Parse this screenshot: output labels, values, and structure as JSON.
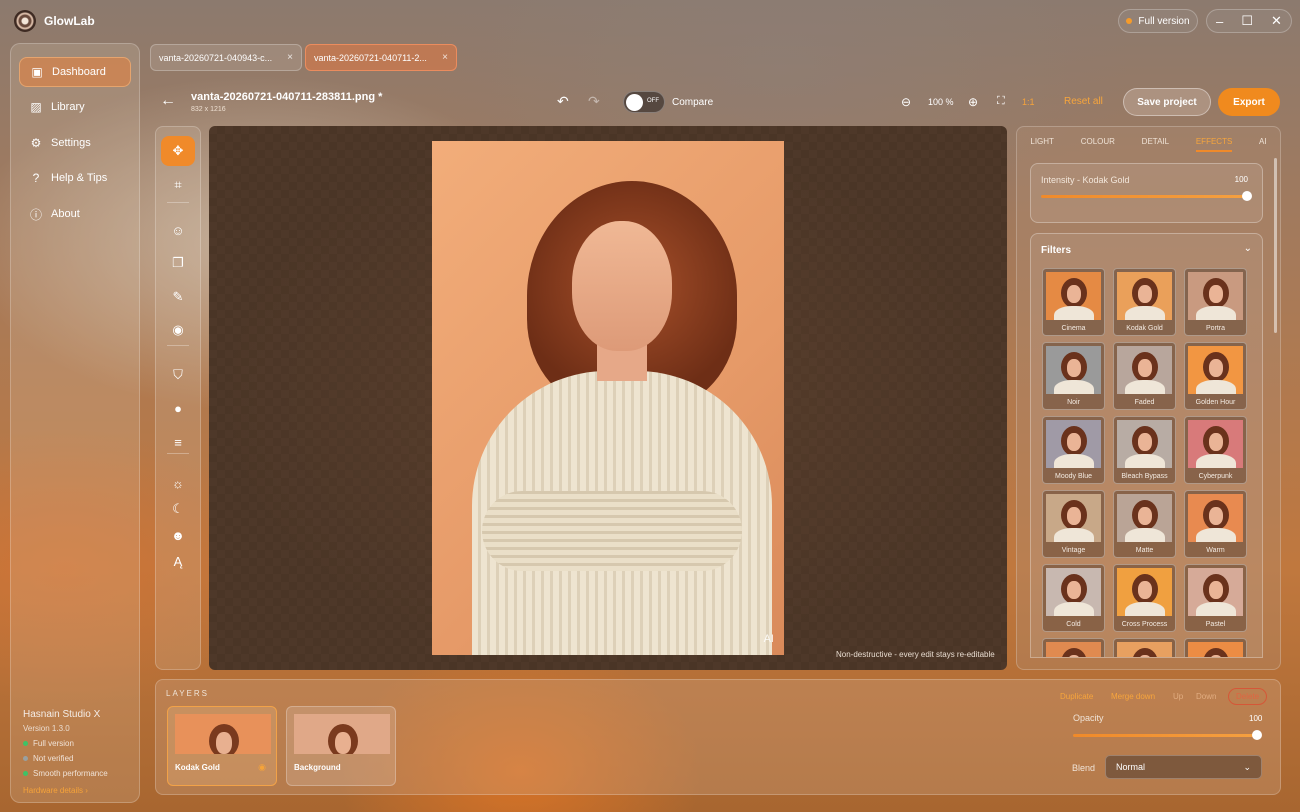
{
  "app": {
    "title": "GlowLab",
    "badge": "Full version"
  },
  "window_controls": {
    "minimize": "–",
    "maximize": "☐",
    "close": "✕"
  },
  "sidebar": {
    "items": [
      {
        "label": "Dashboard",
        "icon": "dashboard-icon",
        "glyph": "▣",
        "active": true
      },
      {
        "label": "Library",
        "icon": "image-icon",
        "glyph": "▨",
        "active": false
      },
      {
        "label": "Settings",
        "icon": "gear-icon",
        "glyph": "⚙",
        "active": false
      },
      {
        "label": "Help & Tips",
        "icon": "question-icon",
        "glyph": "?",
        "active": false
      },
      {
        "label": "About",
        "icon": "info-icon",
        "glyph": "ⓘ",
        "active": false
      }
    ],
    "studio": "Hasnain Studio X",
    "version": "Version 1.3.0",
    "status": [
      "Full version",
      "Not verified",
      "Smooth performance"
    ],
    "hardware_link": "Hardware details ›"
  },
  "tabs": [
    {
      "label": "vanta-20260721-040943-c...",
      "close": "×"
    },
    {
      "label": "vanta-20260721-040711-2...",
      "close": "×"
    }
  ],
  "header": {
    "back": "←",
    "filename": "vanta-20260721-040711-283811.png *",
    "dimensions": "832 x 1216",
    "undo": "↶",
    "redo": "↷",
    "toggle_state": "OFF",
    "compare": "Compare",
    "zoom_out": "⊖",
    "zoom": "100 %",
    "zoom_in": "⊕",
    "fit": "⛶",
    "one_to_one": "1:1",
    "reset": "Reset all",
    "save": "Save project",
    "export": "Export"
  },
  "tools": [
    {
      "name": "move-tool",
      "glyph": "✥"
    },
    {
      "name": "crop-tool",
      "glyph": "⌗"
    },
    {
      "name": "palette-tool",
      "glyph": "☺"
    },
    {
      "name": "clone-tool",
      "glyph": "❐"
    },
    {
      "name": "heal-tool",
      "glyph": "✎"
    },
    {
      "name": "eye-tool",
      "glyph": "◉"
    },
    {
      "name": "bucket-tool",
      "glyph": "⛉"
    },
    {
      "name": "circle-tool",
      "glyph": "●"
    },
    {
      "name": "adjust-tool",
      "glyph": "≡"
    },
    {
      "name": "light-tool",
      "glyph": "☼"
    },
    {
      "name": "night-tool",
      "glyph": "☾"
    },
    {
      "name": "sticker-tool",
      "glyph": "☻"
    },
    {
      "name": "text-tool",
      "glyph": "Ą"
    }
  ],
  "canvas": {
    "ai_label": "AI",
    "note": "Non-destructive - every edit stays re-editable"
  },
  "panel": {
    "tabs": [
      "LIGHT",
      "COLOUR",
      "DETAIL",
      "EFFECTS",
      "AI"
    ],
    "active_tab": "EFFECTS",
    "intensity_label": "Intensity - Kodak Gold",
    "intensity_value": "100",
    "filters_title": "Filters",
    "filters_chevron": "⌄",
    "filters": [
      {
        "name": "Cinema",
        "tint": "#e58a44"
      },
      {
        "name": "Kodak Gold",
        "tint": "#eaa05a"
      },
      {
        "name": "Portra",
        "tint": "#c99a80"
      },
      {
        "name": "Noir",
        "tint": "#9a9a9a"
      },
      {
        "name": "Faded",
        "tint": "#b8a69c"
      },
      {
        "name": "Golden Hour",
        "tint": "#f29642"
      },
      {
        "name": "Moody Blue",
        "tint": "#a09aa6"
      },
      {
        "name": "Bleach Bypass",
        "tint": "#b8aca4"
      },
      {
        "name": "Cyberpunk",
        "tint": "#d87a7a"
      },
      {
        "name": "Vintage",
        "tint": "#c8a888"
      },
      {
        "name": "Matte",
        "tint": "#baa496"
      },
      {
        "name": "Warm",
        "tint": "#e88a50"
      },
      {
        "name": "Cold",
        "tint": "#c8b8b0"
      },
      {
        "name": "Cross Process",
        "tint": "#f0a040"
      },
      {
        "name": "Pastel",
        "tint": "#d6aa98"
      },
      {
        "name": "",
        "tint": "#e08a50"
      },
      {
        "name": "",
        "tint": "#e8a060"
      },
      {
        "name": "",
        "tint": "#ec8c44"
      }
    ]
  },
  "layers": {
    "title": "LAYERS",
    "items": [
      {
        "name": "Kodak Gold",
        "eye": "◉",
        "active": true
      },
      {
        "name": "Background",
        "eye": "",
        "active": false
      }
    ],
    "actions": {
      "duplicate": "Duplicate",
      "merge": "Merge down",
      "up": "Up",
      "down": "Down",
      "delete": "Delete"
    },
    "opacity_label": "Opacity",
    "opacity_value": "100",
    "opacity_fraction": 1.0,
    "blend_label": "Blend",
    "blend_value": "Normal",
    "blend_chevron": "⌄"
  },
  "colors": {
    "accent": "#f08a2a",
    "link": "#f5a33a",
    "status_ok": "#3fc266"
  }
}
